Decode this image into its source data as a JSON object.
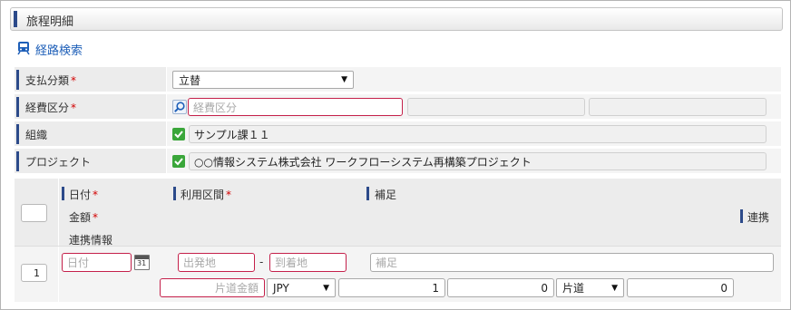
{
  "section": {
    "title": "旅程明細"
  },
  "route_search": {
    "label": "経路検索"
  },
  "form": {
    "payment_type": {
      "label": "支払分類",
      "required_mark": "*",
      "value": "立替"
    },
    "expense_category": {
      "label": "経費区分",
      "required_mark": "*",
      "placeholder": "経費区分"
    },
    "organization": {
      "label": "組織",
      "value": "サンプル課１１"
    },
    "project": {
      "label": "プロジェクト",
      "value": "○○情報システム株式会社 ワークフローシステム再構築プロジェクト"
    }
  },
  "table": {
    "headers": {
      "date": "日付",
      "date_req": "*",
      "section": "利用区間",
      "section_req": "*",
      "note": "補足",
      "amount": "金額",
      "amount_req": "*",
      "link": "連携",
      "link_info": "連携情報"
    },
    "row": {
      "index": "1",
      "date_placeholder": "日付",
      "calendar_day": "31",
      "from_placeholder": "出発地",
      "separator": "-",
      "to_placeholder": "到着地",
      "note_placeholder": "補足",
      "oneway_placeholder": "片道金額",
      "currency": "JPY",
      "rate": "1",
      "amount": "0",
      "trip_type": "片道",
      "total": "0"
    }
  },
  "colors": {
    "accent": "#2c4a8a",
    "required": "#d20000",
    "checkbox": "#3aa63a",
    "link": "#1e5fb8"
  }
}
